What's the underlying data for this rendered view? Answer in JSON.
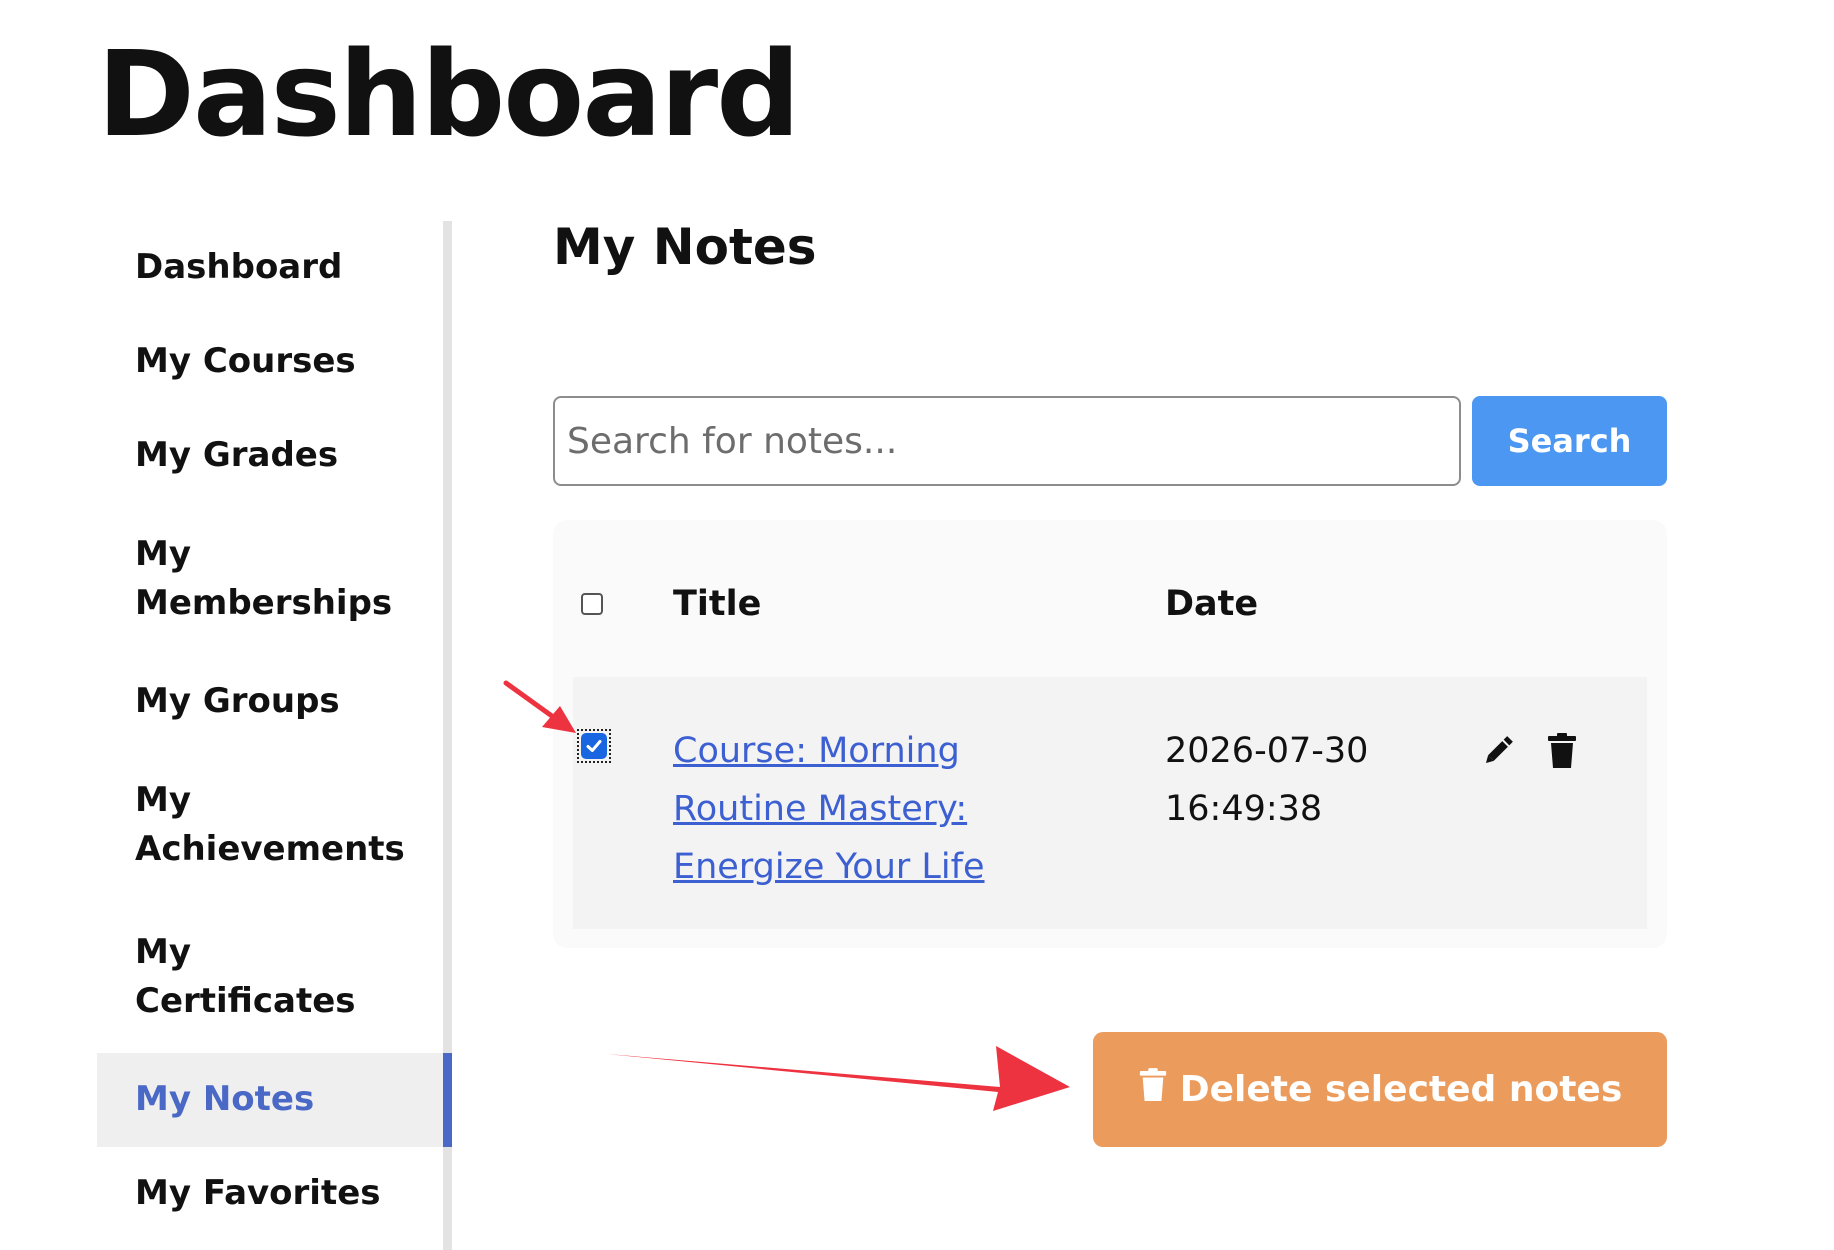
{
  "page": {
    "title": "Dashboard"
  },
  "sidebar": {
    "items": [
      {
        "label": "Dashboard"
      },
      {
        "label": "My Courses"
      },
      {
        "label": "My Grades"
      },
      {
        "label": "My Memberships"
      },
      {
        "label": "My Groups"
      },
      {
        "label": "My Achievements"
      },
      {
        "label": "My Certificates"
      },
      {
        "label": "My Notes",
        "active": true
      },
      {
        "label": "My Favorites"
      }
    ]
  },
  "main": {
    "section_title": "My Notes",
    "search": {
      "placeholder": "Search for notes...",
      "value": "",
      "button_label": "Search"
    },
    "table": {
      "headers": {
        "title": "Title",
        "date": "Date"
      },
      "rows": [
        {
          "checked": true,
          "title": "Course: Morning Routine Mastery: Energize Your Life",
          "date": "2026-07-30 16:49:38"
        }
      ]
    },
    "delete_button_label": "Delete selected notes"
  },
  "icons": {
    "edit": "pencil-icon",
    "delete": "trash-icon",
    "bulk_delete": "trash-icon",
    "annotations": "red-arrow-icon"
  },
  "colors": {
    "accent": "#4a68c6",
    "search_button": "#4c97f2",
    "delete_button": "#eb9b5c",
    "annotation": "#ee3340"
  }
}
